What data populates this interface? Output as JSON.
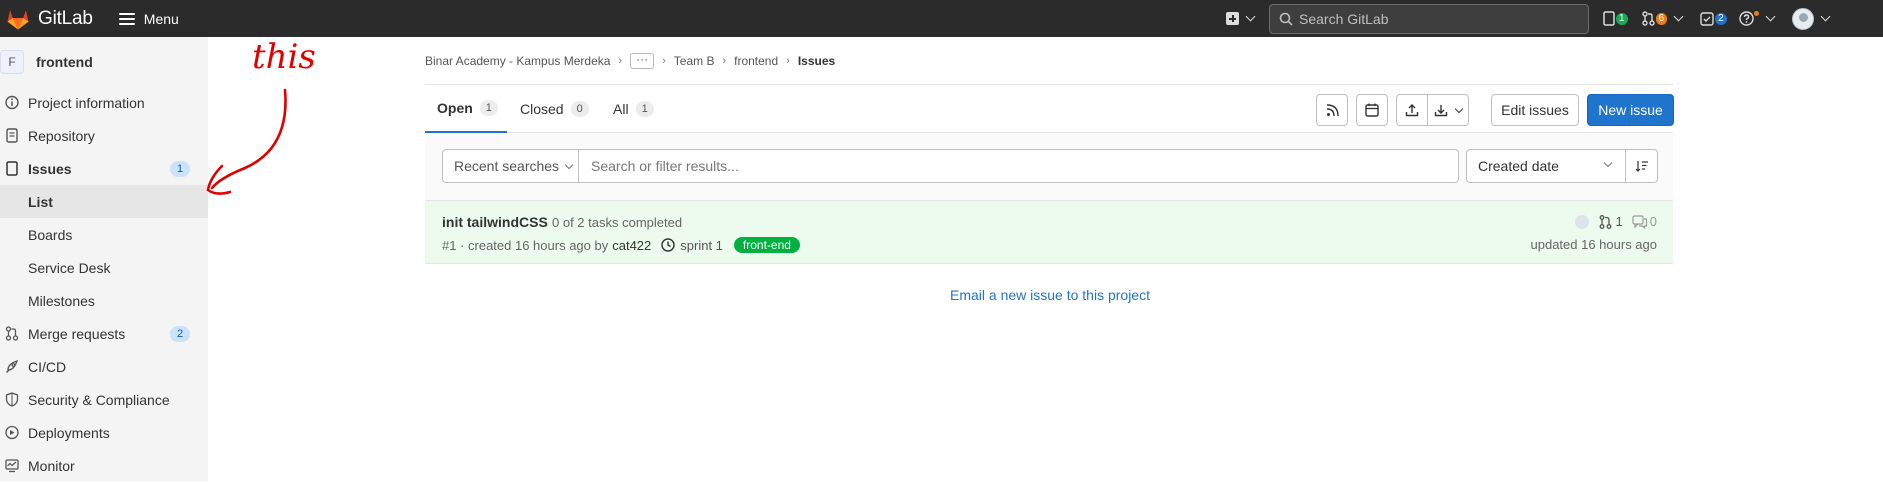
{
  "topbar": {
    "brand": "GitLab",
    "menu_label": "Menu",
    "search_placeholder": "Search GitLab",
    "issues_count": "1",
    "mr_count": "6",
    "todos_count": "2",
    "colors": {
      "bg": "#2b2b2b",
      "issues_badge": "#1aaa55",
      "mr_badge": "#e97e18",
      "todo_badge": "#1f75cb"
    }
  },
  "sidebar": {
    "project_initial": "F",
    "project_name": "frontend",
    "items": [
      {
        "label": "Project information",
        "icon": "info-icon"
      },
      {
        "label": "Repository",
        "icon": "doc-icon"
      },
      {
        "label": "Issues",
        "icon": "issues-icon",
        "count": "1"
      },
      {
        "label": "List"
      },
      {
        "label": "Boards"
      },
      {
        "label": "Service Desk"
      },
      {
        "label": "Milestones"
      },
      {
        "label": "Merge requests",
        "icon": "merge-icon",
        "count": "2"
      },
      {
        "label": "CI/CD",
        "icon": "rocket-icon"
      },
      {
        "label": "Security & Compliance",
        "icon": "shield-icon"
      },
      {
        "label": "Deployments",
        "icon": "deploy-icon"
      },
      {
        "label": "Monitor",
        "icon": "monitor-icon"
      }
    ]
  },
  "breadcrumb": {
    "group": "Binar Academy - Kampus Merdeka",
    "ellipsis": "···",
    "subgroup": "Team B",
    "project": "frontend",
    "current": "Issues"
  },
  "tabs": [
    {
      "label": "Open",
      "count": "1"
    },
    {
      "label": "Closed",
      "count": "0"
    },
    {
      "label": "All",
      "count": "1"
    }
  ],
  "actions": {
    "edit_label": "Edit issues",
    "new_label": "New issue"
  },
  "filter": {
    "recent_label": "Recent searches",
    "placeholder": "Search or filter results...",
    "sort_label": "Created date"
  },
  "issue": {
    "title": "init tailwindCSS",
    "tasks": "0 of 2 tasks completed",
    "ref": "#1 · created 16 hours ago by",
    "author": "cat422",
    "milestone": "sprint 1",
    "label": "front-end",
    "mr_count": "1",
    "comments": "0",
    "updated": "updated 16 hours ago"
  },
  "email_link": "Email a new issue to this project",
  "annotation": "this"
}
